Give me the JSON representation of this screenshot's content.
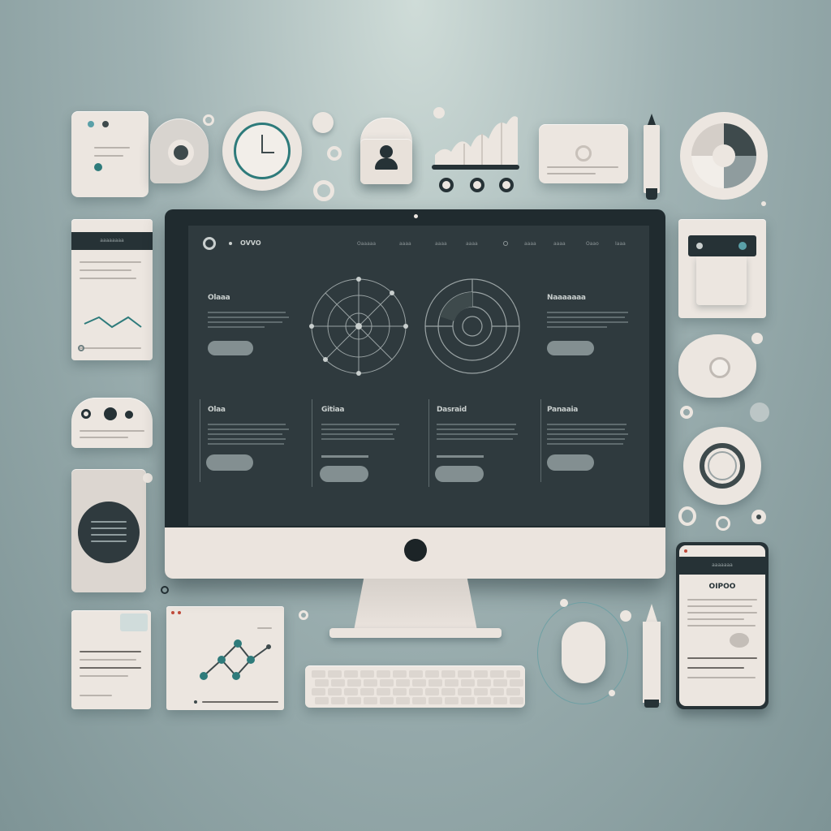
{
  "website": {
    "logo_text": "OVVO",
    "nav": [
      "Oaaaaa",
      "aaaa",
      "aaaa",
      "aaaa",
      "aaaa",
      "aaaa",
      "Oaao",
      "Iaaa"
    ],
    "hero_left_title": "Olaaa",
    "hero_right_title": "Naaaaaaa",
    "cards": [
      {
        "title": "Olaa"
      },
      {
        "title": "Gitiaa"
      },
      {
        "title": "Dasraid"
      },
      {
        "title": "Panaaia"
      }
    ]
  },
  "left_doc_card": {
    "header": "aaaaaaaa"
  },
  "right_phone": {
    "header": "aaaaaaa",
    "title": "OIPOO"
  },
  "colors": {
    "background": "#93a8aa",
    "monitor_frame": "#202b2f",
    "screen": "#2f3a3e",
    "card": "#ece6e0",
    "accent_teal": "#2e7b7b"
  },
  "icons": [
    "clock-icon",
    "lock-icon",
    "user-icon",
    "chart-icon",
    "pencil-icon",
    "pie-chart-icon",
    "mouse-icon",
    "keyboard-icon",
    "graph-icon",
    "power-icon"
  ]
}
